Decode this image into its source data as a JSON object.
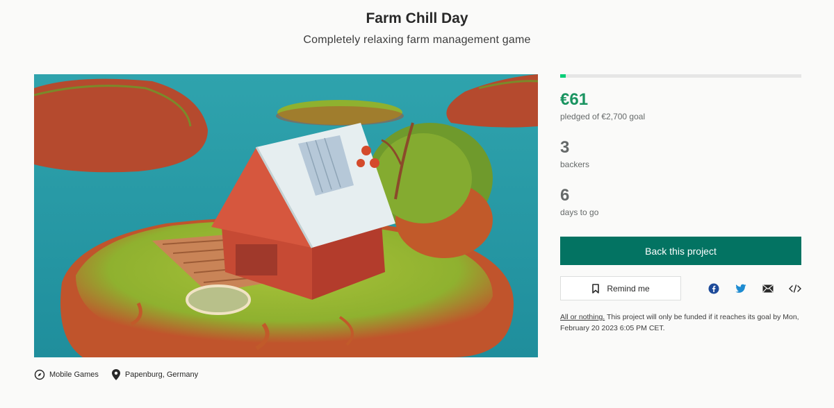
{
  "project": {
    "title": "Farm Chill Day",
    "subtitle": "Completely relaxing farm management game"
  },
  "hero": {
    "image_description_icon": "painted-farmhouse-island-image"
  },
  "meta": {
    "category": "Mobile Games",
    "category_icon": "compass-icon",
    "location": "Papenburg, Germany",
    "location_icon": "map-pin-icon"
  },
  "funding": {
    "progress_fraction": 0.023,
    "pledged": "€61",
    "pledged_label": "pledged of €2,700 goal",
    "backers": "3",
    "backers_label": "backers",
    "days": "6",
    "days_label": "days to go"
  },
  "actions": {
    "back_label": "Back this project",
    "remind_label": "Remind me",
    "share_icons": [
      "facebook-icon",
      "twitter-icon",
      "email-icon",
      "embed-icon"
    ]
  },
  "terms": {
    "link_text": "All or nothing.",
    "text": " This project will only be funded if it reaches its goal by Mon, February 20 2023 6:05 PM CET."
  },
  "colors": {
    "accent": "#037362",
    "money": "#1a9461",
    "progress": "#05ce78"
  }
}
